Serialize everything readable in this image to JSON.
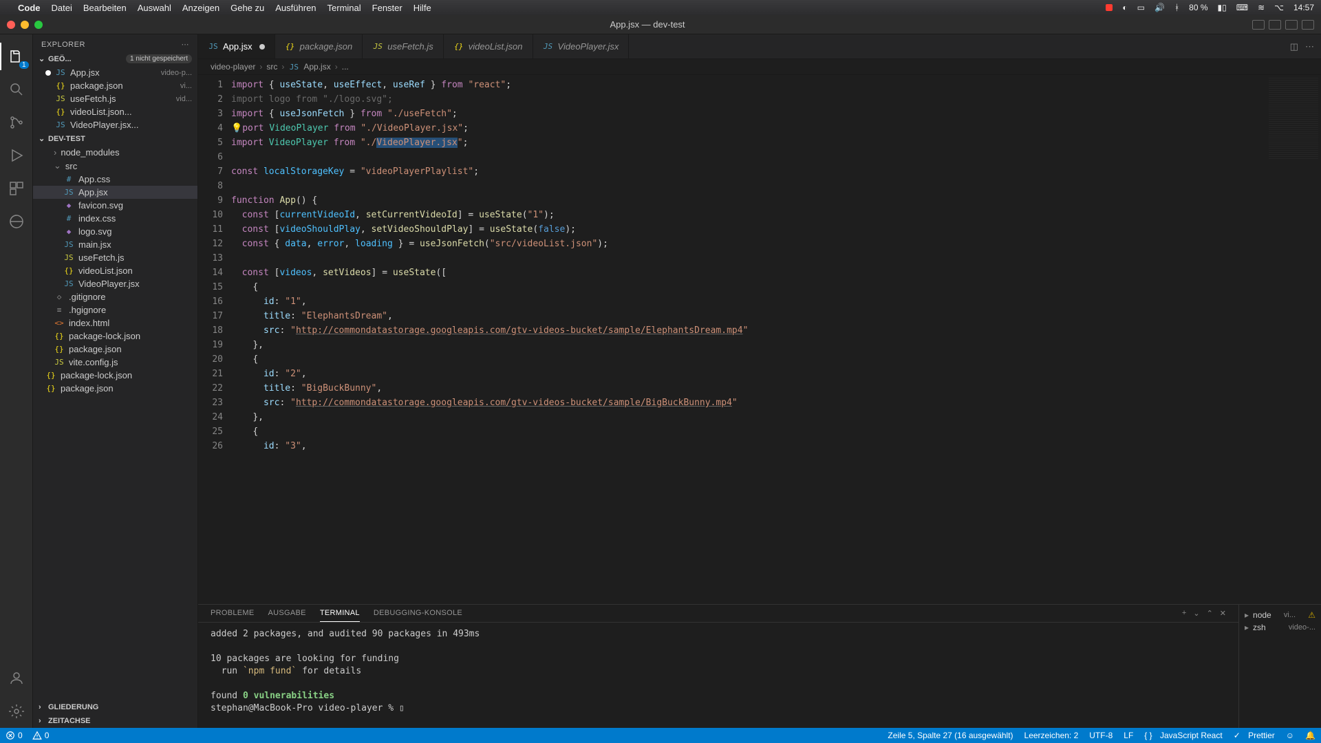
{
  "mac_menu": {
    "app": "Code",
    "items": [
      "Datei",
      "Bearbeiten",
      "Auswahl",
      "Anzeigen",
      "Gehe zu",
      "Ausführen",
      "Terminal",
      "Fenster",
      "Hilfe"
    ],
    "battery": "80 %",
    "time": "14:57"
  },
  "window_title": "App.jsx — dev-test",
  "activity_badge": "1",
  "explorer": {
    "title": "EXPLORER",
    "open_editors": {
      "label": "GEÖ...",
      "unsaved": "1 nicht gespeichert",
      "items": [
        {
          "name": "App.jsx",
          "hint": "video-p...",
          "modified": true,
          "icon": "JS",
          "cls": "fi-jsx"
        },
        {
          "name": "package.json",
          "hint": "vi...",
          "icon": "{}",
          "cls": "fi-json"
        },
        {
          "name": "useFetch.js",
          "hint": "vid...",
          "icon": "JS",
          "cls": "fi-js"
        },
        {
          "name": "videoList.json...",
          "hint": "",
          "icon": "{}",
          "cls": "fi-json"
        },
        {
          "name": "VideoPlayer.jsx...",
          "hint": "",
          "icon": "JS",
          "cls": "fi-jsx"
        }
      ]
    },
    "project": {
      "label": "DEV-TEST",
      "tree": [
        {
          "name": "node_modules",
          "type": "folder",
          "indent": 1
        },
        {
          "name": "src",
          "type": "folder-open",
          "indent": 1
        },
        {
          "name": "App.css",
          "icon": "#",
          "cls": "fi-css",
          "indent": 2
        },
        {
          "name": "App.jsx",
          "icon": "JS",
          "cls": "fi-jsx",
          "indent": 2,
          "active": true
        },
        {
          "name": "favicon.svg",
          "icon": "◆",
          "cls": "fi-svg",
          "indent": 2
        },
        {
          "name": "index.css",
          "icon": "#",
          "cls": "fi-css",
          "indent": 2
        },
        {
          "name": "logo.svg",
          "icon": "◆",
          "cls": "fi-svg",
          "indent": 2
        },
        {
          "name": "main.jsx",
          "icon": "JS",
          "cls": "fi-jsx",
          "indent": 2
        },
        {
          "name": "useFetch.js",
          "icon": "JS",
          "cls": "fi-js",
          "indent": 2
        },
        {
          "name": "videoList.json",
          "icon": "{}",
          "cls": "fi-json",
          "indent": 2
        },
        {
          "name": "VideoPlayer.jsx",
          "icon": "JS",
          "cls": "fi-jsx",
          "indent": 2
        },
        {
          "name": ".gitignore",
          "icon": "◇",
          "cls": "fi-generic",
          "indent": 1
        },
        {
          "name": ".hgignore",
          "icon": "≡",
          "cls": "fi-generic",
          "indent": 1
        },
        {
          "name": "index.html",
          "icon": "<>",
          "cls": "fi-html",
          "indent": 1
        },
        {
          "name": "package-lock.json",
          "icon": "{}",
          "cls": "fi-json",
          "indent": 1
        },
        {
          "name": "package.json",
          "icon": "{}",
          "cls": "fi-json",
          "indent": 1
        },
        {
          "name": "vite.config.js",
          "icon": "JS",
          "cls": "fi-js",
          "indent": 1
        },
        {
          "name": "package-lock.json",
          "icon": "{}",
          "cls": "fi-json",
          "indent": 0
        },
        {
          "name": "package.json",
          "icon": "{}",
          "cls": "fi-json",
          "indent": 0
        }
      ]
    },
    "outline": "GLIEDERUNG",
    "timeline": "ZEITACHSE"
  },
  "tabs": [
    {
      "label": "App.jsx",
      "icon": "JS",
      "cls": "fi-jsx",
      "active": true,
      "modified": true
    },
    {
      "label": "package.json",
      "icon": "{}",
      "cls": "fi-json"
    },
    {
      "label": "useFetch.js",
      "icon": "JS",
      "cls": "fi-js"
    },
    {
      "label": "videoList.json",
      "icon": "{}",
      "cls": "fi-json"
    },
    {
      "label": "VideoPlayer.jsx",
      "icon": "JS",
      "cls": "fi-jsx"
    }
  ],
  "breadcrumbs": [
    "video-player",
    "src",
    "App.jsx",
    "..."
  ],
  "code_lines": 26,
  "panel": {
    "tabs": [
      "PROBLEME",
      "AUSGABE",
      "TERMINAL",
      "DEBUGGING-KONSOLE"
    ],
    "active": 2,
    "terminal": "added 2 packages, and audited 90 packages in 493ms\n\n10 packages are looking for funding\n  run `npm fund` for details\n\nfound 0 vulnerabilities\nstephan@MacBook-Pro video-player % ▯",
    "side": [
      {
        "icon": "▸",
        "label": "node",
        "hint": "vi...",
        "warn": true
      },
      {
        "icon": "▸",
        "label": "zsh",
        "hint": "video-..."
      }
    ]
  },
  "status": {
    "errors": "0",
    "warnings": "0",
    "cursor": "Zeile 5, Spalte 27 (16 ausgewählt)",
    "spaces": "Leerzeichen: 2",
    "encoding": "UTF-8",
    "eol": "LF",
    "lang_icon": "{ }",
    "lang": "JavaScript React",
    "prettier": "Prettier",
    "prettier_check": "✓"
  }
}
